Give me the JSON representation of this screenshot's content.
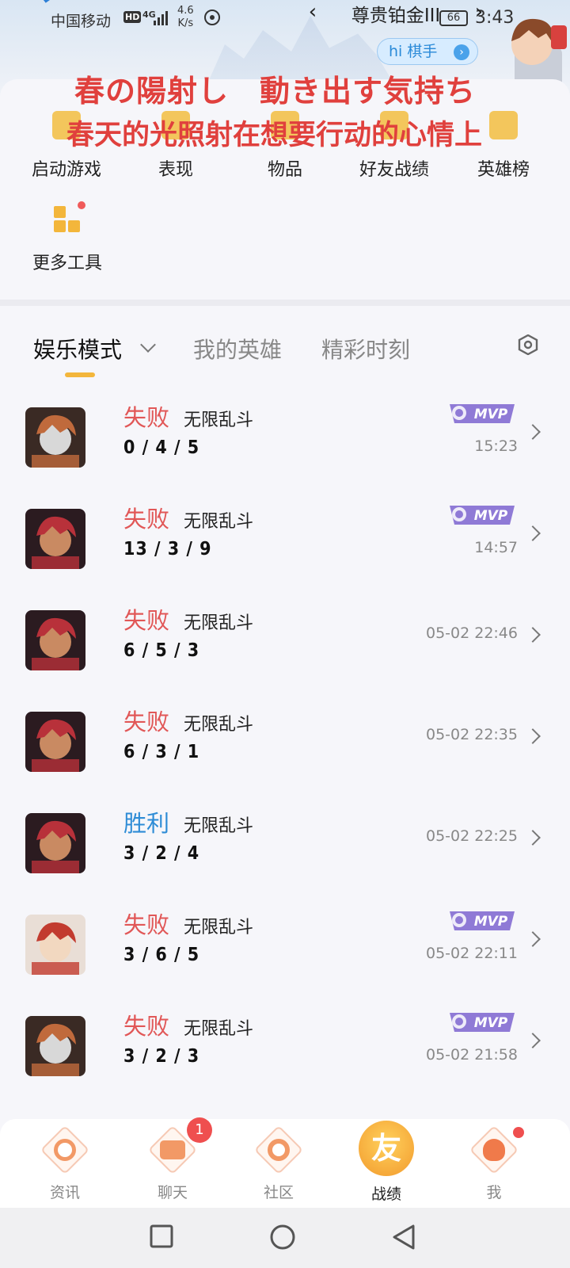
{
  "status_bar": {
    "carrier": "中国移动",
    "hd": "HD",
    "network": "4G",
    "speed_value": "4.6",
    "speed_unit": "K/s",
    "battery": "66",
    "time": "3:43"
  },
  "rank": {
    "prev_symbol": "‹",
    "title": "尊贵铂金III",
    "next_symbol": "›"
  },
  "hi_badge": {
    "label": "hi 棋手",
    "arrow": "›"
  },
  "overlay": {
    "japanese": "春の陽射し　動き出す気持ち",
    "chinese": "春天的光照射在想要行动的心情上"
  },
  "tools": [
    {
      "label": "启动游戏",
      "icon": "gamepad-icon"
    },
    {
      "label": "表现",
      "icon": "trophy-icon"
    },
    {
      "label": "物品",
      "icon": "box-icon"
    },
    {
      "label": "好友战绩",
      "icon": "friends-icon"
    },
    {
      "label": "英雄榜",
      "icon": "medal-icon"
    }
  ],
  "more_tool": {
    "label": "更多工具",
    "icon": "grid-icon"
  },
  "tabs": [
    {
      "label": "娱乐模式"
    },
    {
      "label": "我的英雄"
    },
    {
      "label": "精彩时刻"
    }
  ],
  "colors": {
    "accent": "#f3b63b",
    "lose": "#e15757",
    "win": "#2e8cd6",
    "mvp": "#8f7ad6"
  },
  "matches": [
    {
      "result": "失败",
      "type": "lose",
      "mode": "无限乱斗",
      "kda": "0 / 4 / 5",
      "time": "15:23",
      "mvp": true,
      "hero": "hero-a"
    },
    {
      "result": "失败",
      "type": "lose",
      "mode": "无限乱斗",
      "kda": "13 / 3 / 9",
      "time": "14:57",
      "mvp": true,
      "hero": "hero-b"
    },
    {
      "result": "失败",
      "type": "lose",
      "mode": "无限乱斗",
      "kda": "6 / 5 / 3",
      "time": "05-02 22:46",
      "mvp": false,
      "hero": "hero-b"
    },
    {
      "result": "失败",
      "type": "lose",
      "mode": "无限乱斗",
      "kda": "6 / 3 / 1",
      "time": "05-02 22:35",
      "mvp": false,
      "hero": "hero-b"
    },
    {
      "result": "胜利",
      "type": "win",
      "mode": "无限乱斗",
      "kda": "3 / 2 / 4",
      "time": "05-02 22:25",
      "mvp": false,
      "hero": "hero-b"
    },
    {
      "result": "失败",
      "type": "lose",
      "mode": "无限乱斗",
      "kda": "3 / 6 / 5",
      "time": "05-02 22:11",
      "mvp": true,
      "hero": "hero-c"
    },
    {
      "result": "失败",
      "type": "lose",
      "mode": "无限乱斗",
      "kda": "3 / 2 / 3",
      "time": "05-02 21:58",
      "mvp": true,
      "hero": "hero-a"
    }
  ],
  "mvp_label": "MVP",
  "bottom_nav": [
    {
      "label": "资讯",
      "icon": "news-icon"
    },
    {
      "label": "聊天",
      "icon": "chat-icon",
      "badge": "1"
    },
    {
      "label": "社区",
      "icon": "community-icon"
    },
    {
      "label": "战绩",
      "icon": "record-icon",
      "glyph": "友"
    },
    {
      "label": "我",
      "icon": "profile-icon"
    }
  ]
}
